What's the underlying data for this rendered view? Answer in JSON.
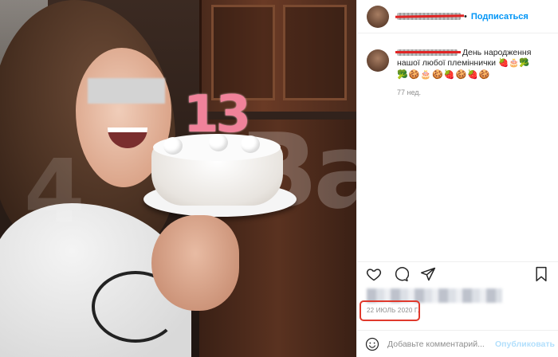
{
  "post": {
    "photo": {
      "alt_candle_number": "13",
      "watermark": "Вач",
      "watermark_left": "4"
    }
  },
  "header": {
    "username_redacted": true,
    "separator": "•",
    "follow_label": "Подписаться"
  },
  "caption": {
    "text": "День народження нашої любої племіннички",
    "emojis_inline": "🍓🎂🥦",
    "emojis_line": "🥦🍪🎂🍪🍓🍪🍓🍪",
    "time_ago": "77 нед."
  },
  "actions": {
    "like_icon": "heart-icon",
    "comment_icon": "comment-icon",
    "share_icon": "share-icon",
    "save_icon": "bookmark-icon"
  },
  "meta": {
    "date": "22 ИЮЛЬ 2020 Г."
  },
  "comment_box": {
    "emoji_icon": "smiley-icon",
    "placeholder": "Добавьте комментарий...",
    "publish_label": "Опубликовать"
  },
  "colors": {
    "accent": "#0095f6",
    "publish_disabled": "#b2dffc",
    "highlight_box": "#e0392c",
    "redaction_line": "#e02424"
  }
}
